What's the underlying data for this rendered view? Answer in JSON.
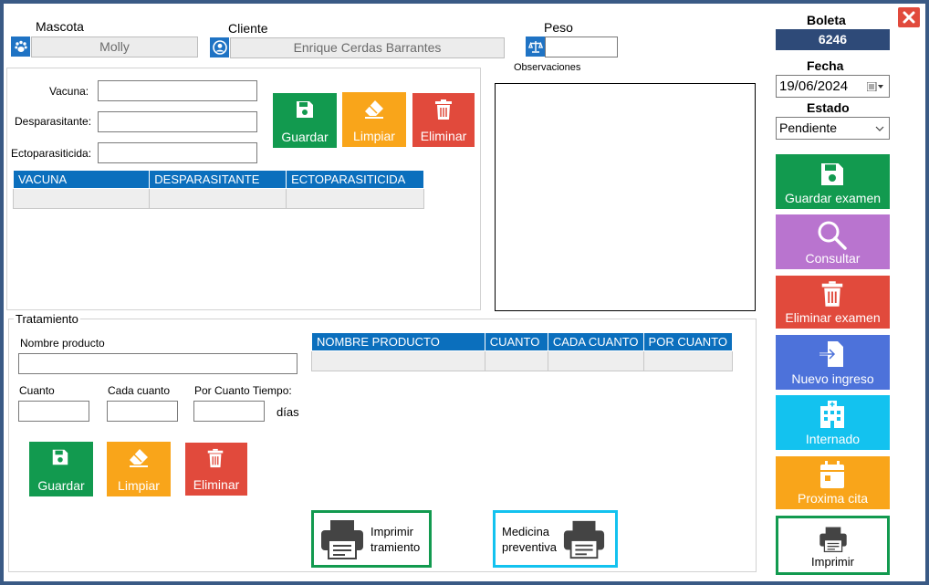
{
  "pet": {
    "label": "Mascota",
    "value": "Molly",
    "icon": "paw-icon"
  },
  "client": {
    "label": "Cliente",
    "value": "Enrique Cerdas Barrantes",
    "icon": "user-icon"
  },
  "weight": {
    "label": "Peso",
    "value": "",
    "icon": "scale-icon"
  },
  "observations": {
    "label": "Observaciones",
    "value": ""
  },
  "boleta": {
    "label": "Boleta",
    "value": "6246"
  },
  "fecha": {
    "label": "Fecha",
    "value": "19/06/2024"
  },
  "estado": {
    "label": "Estado",
    "value": "Pendiente"
  },
  "vaccines": {
    "vacuna_label": "Vacuna:",
    "desparasitante_label": "Desparasitante:",
    "ectoparasiticida_label": "Ectoparasiticida:",
    "guardar": "Guardar",
    "limpiar": "Limpiar",
    "eliminar": "Eliminar",
    "columns": [
      "VACUNA",
      "DESPARASITANTE",
      "ECTOPARASITICIDA"
    ]
  },
  "treatment": {
    "title": "Tratamiento",
    "nombre_label": "Nombre producto",
    "cuanto_label": "Cuanto",
    "cada_label": "Cada cuanto",
    "por_label": "Por Cuanto Tiempo:",
    "dias": "días",
    "guardar": "Guardar",
    "limpiar": "Limpiar",
    "eliminar": "Eliminar",
    "columns": [
      "NOMBRE PRODUCTO",
      "CUANTO",
      "CADA CUANTO",
      "POR CUANTO"
    ]
  },
  "print": {
    "treatment_line1": "Imprimir",
    "treatment_line2": "tramiento",
    "medicine_line1": "Medicina",
    "medicine_line2": "preventiva"
  },
  "side": {
    "guardar_examen": "Guardar examen",
    "consultar": "Consultar",
    "eliminar_examen": "Eliminar examen",
    "nuevo_ingreso": "Nuevo ingreso",
    "internado": "Internado",
    "proxima_cita": "Proxima cita",
    "imprimir": "Imprimir"
  },
  "colors": {
    "green": "#129a4f",
    "orange": "#f9a51a",
    "red": "#e14a3c",
    "purple": "#b974cf",
    "blue": "#4d72da",
    "cyan": "#13c2ef",
    "header_blue": "#0b6fbd",
    "boleta_bg": "#2e4a78"
  }
}
